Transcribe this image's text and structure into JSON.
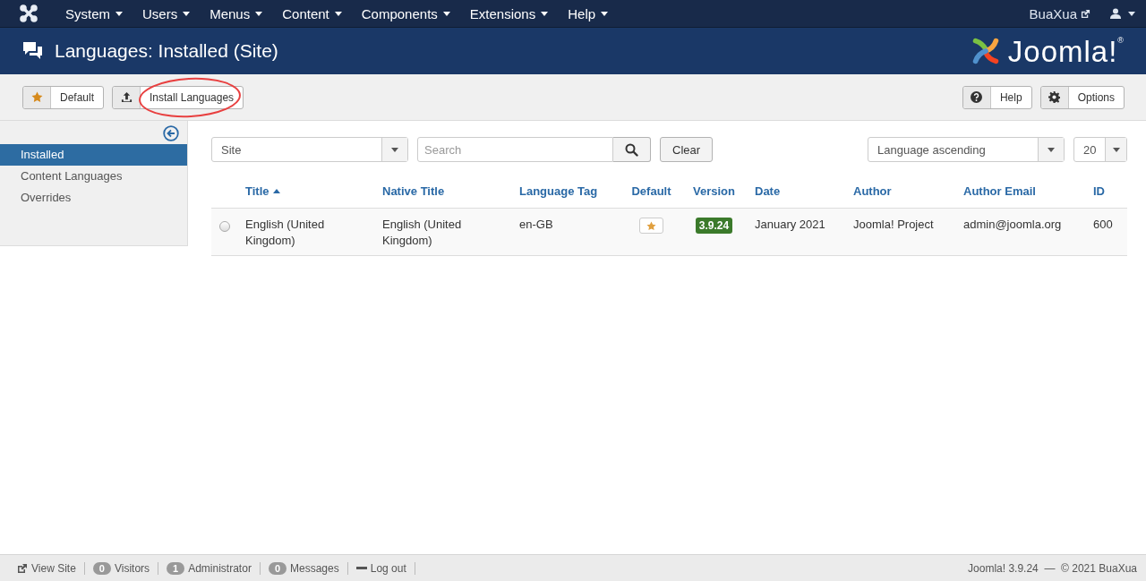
{
  "navbar": {
    "menus": [
      {
        "label": "System"
      },
      {
        "label": "Users"
      },
      {
        "label": "Menus"
      },
      {
        "label": "Content"
      },
      {
        "label": "Components"
      },
      {
        "label": "Extensions"
      },
      {
        "label": "Help"
      }
    ],
    "site_link": "BuaXua"
  },
  "header": {
    "title": "Languages: Installed (Site)",
    "logo_text": "Joomla!",
    "logo_mark": "®"
  },
  "toolbar": {
    "left": [
      {
        "label": "Default",
        "kind": "star",
        "highlighted": false
      },
      {
        "label": "Install Languages",
        "kind": "upload",
        "highlighted": true
      }
    ],
    "right": [
      {
        "label": "Help",
        "kind": "question",
        "highlighted": false
      },
      {
        "label": "Options",
        "kind": "gear",
        "highlighted": false
      }
    ]
  },
  "sidebar": {
    "items": [
      {
        "label": "Installed",
        "selected": true
      },
      {
        "label": "Content Languages",
        "selected": false
      },
      {
        "label": "Overrides",
        "selected": false
      }
    ]
  },
  "filters": {
    "client": "Site",
    "search": {
      "placeholder": "Search"
    },
    "clear": "Clear",
    "ordering": "Language ascending",
    "limit": "20"
  },
  "table": {
    "columns": [
      {
        "label": "Title",
        "sorted": true
      },
      {
        "label": "Native Title",
        "sorted": false
      },
      {
        "label": "Language Tag",
        "sorted": false
      },
      {
        "label": "Default",
        "sorted": false
      },
      {
        "label": "Version",
        "sorted": false
      },
      {
        "label": "Date",
        "sorted": false
      },
      {
        "label": "Author",
        "sorted": false
      },
      {
        "label": "Author Email",
        "sorted": false
      },
      {
        "label": "ID",
        "sorted": false
      }
    ],
    "rows": [
      {
        "selected": false,
        "title": "English (United Kingdom)",
        "native_title": "English (United Kingdom)",
        "tag": "en-GB",
        "default": true,
        "version": "3.9.24",
        "date": "January 2021",
        "author": "Joomla! Project",
        "email": "admin@joomla.org",
        "id": "600"
      }
    ]
  },
  "status_bar": {
    "items": [
      {
        "kind": "link",
        "label": "View Site"
      },
      {
        "kind": "count",
        "count": "0",
        "label": "Visitors"
      },
      {
        "kind": "count",
        "count": "1",
        "label": "Administrator"
      },
      {
        "kind": "count",
        "count": "0",
        "label": "Messages"
      },
      {
        "kind": "logout",
        "label": "Log out"
      }
    ],
    "copyright": "Joomla! 3.9.24  —  © 2021 BuaXua"
  }
}
